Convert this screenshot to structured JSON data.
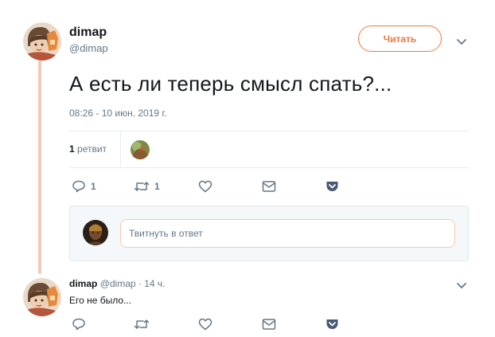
{
  "tweet": {
    "author_name": "dimap",
    "author_handle": "@dimap",
    "follow_label": "Читать",
    "text": "А есть ли теперь смысл спать?...",
    "timestamp": "08:26 - 10 июн. 2019 г."
  },
  "stats": {
    "retweet_count": "1",
    "retweet_label": "ретвит"
  },
  "actions": {
    "reply_count": "1",
    "retweet_count": "1",
    "like_count": "",
    "icons": [
      "reply-icon",
      "retweet-icon",
      "like-icon",
      "message-icon",
      "pocket-icon"
    ]
  },
  "reply_composer": {
    "placeholder": "Твитнуть в ответ"
  },
  "reply_tweet": {
    "author_name": "dimap",
    "author_handle": "@dimap",
    "separator": "·",
    "time": "14 ч.",
    "text": "Его не было..."
  },
  "colors": {
    "accent": "#f4753f",
    "thread_line": "#f6c8b9",
    "secondary_text": "#657786",
    "pocket": "#4a5a75"
  }
}
